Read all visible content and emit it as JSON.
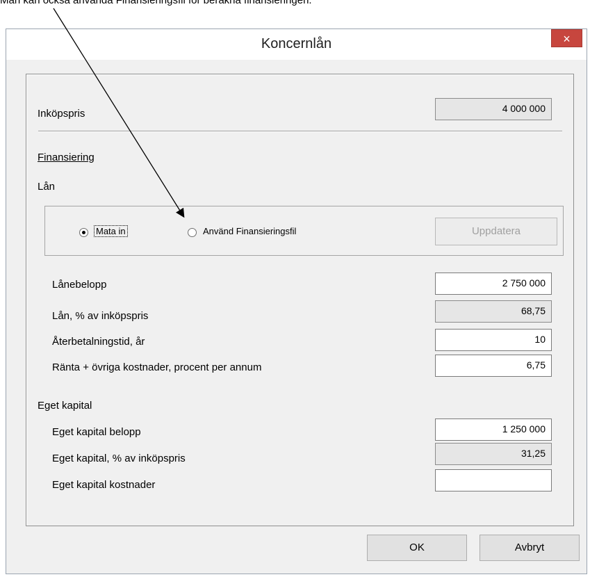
{
  "caption": "Man kan också använda Finansieringsfil för beräkna finansieringen.",
  "dialog": {
    "title": "Koncernlån",
    "close_label": "×",
    "purchase_price_label": "Inköpspris",
    "purchase_price_value": "4 000 000",
    "financing_label": "Finansiering",
    "loan_label": "Lån",
    "radio_options": [
      {
        "label": "Mata in",
        "selected": true
      },
      {
        "label": "Använd Finansieringsfil",
        "selected": false
      }
    ],
    "update_button": "Uppdatera",
    "loan_fields": [
      {
        "label": "Lånebelopp",
        "value": "2 750 000",
        "readonly": false
      },
      {
        "label": "Lån, % av inköpspris",
        "value": "68,75",
        "readonly": true
      },
      {
        "label": "Återbetalningstid, år",
        "value": "10",
        "readonly": false
      },
      {
        "label": "Ränta + övriga kostnader, procent per annum",
        "value": "6,75",
        "readonly": false
      }
    ],
    "equity_label": "Eget kapital",
    "equity_fields": [
      {
        "label": "Eget kapital belopp",
        "value": "1 250 000",
        "readonly": false
      },
      {
        "label": "Eget kapital, % av inköpspris",
        "value": "31,25",
        "readonly": true
      },
      {
        "label": "Eget kapital kostnader",
        "value": "",
        "readonly": false
      }
    ],
    "ok_button": "OK",
    "cancel_button": "Avbryt"
  },
  "colors": {
    "close_button": "#c7463e",
    "dialog_background": "#f0f0f0",
    "readonly_field": "#e6e6e6"
  }
}
